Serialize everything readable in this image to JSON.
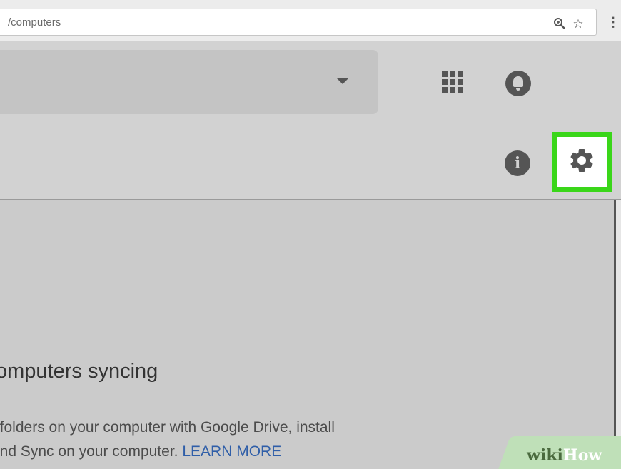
{
  "browser": {
    "url_fragment": "/computers",
    "icons": [
      "zoom-icon",
      "star-icon",
      "more-vert-icon"
    ]
  },
  "appbar": {
    "search_dropdown_icon": "caret-down-icon",
    "apps_icon": "apps-grid-icon",
    "notifications_icon": "bell-icon",
    "info_icon": "info-icon",
    "settings_icon": "gear-icon"
  },
  "content": {
    "heading_fragment": "omputers syncing",
    "desc_line1_fragment": ": folders on your computer with Google Drive, install",
    "desc_line2_fragment": " and Sync on your computer.",
    "learn_more_label": "LEARN MORE"
  },
  "watermark": {
    "wiki": "wiki",
    "how": "How"
  },
  "colors": {
    "highlight": "#3ad619",
    "link": "#2f5ea8",
    "icon": "#555555"
  }
}
